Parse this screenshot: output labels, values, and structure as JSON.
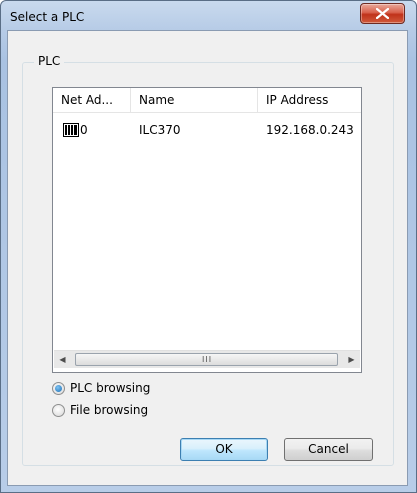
{
  "window": {
    "title": "Select a PLC",
    "close_label": "X"
  },
  "group": {
    "legend": "PLC"
  },
  "list": {
    "columns": [
      "Net Ad...",
      "Name",
      "IP Address"
    ],
    "rows": [
      {
        "net_address": "0",
        "name": "ILC370",
        "ip_address": "192.168.0.243",
        "icon": "plc-device-icon"
      }
    ],
    "scroll_grip": "III"
  },
  "options": {
    "plc_browsing": {
      "label": "PLC browsing",
      "selected": true
    },
    "file_browsing": {
      "label": "File browsing",
      "selected": false
    }
  },
  "buttons": {
    "ok": "OK",
    "cancel": "Cancel"
  },
  "colors": {
    "titlebar": "#b6cbe6",
    "close_button": "#c0321a",
    "default_button_border": "#3c7fb1"
  }
}
